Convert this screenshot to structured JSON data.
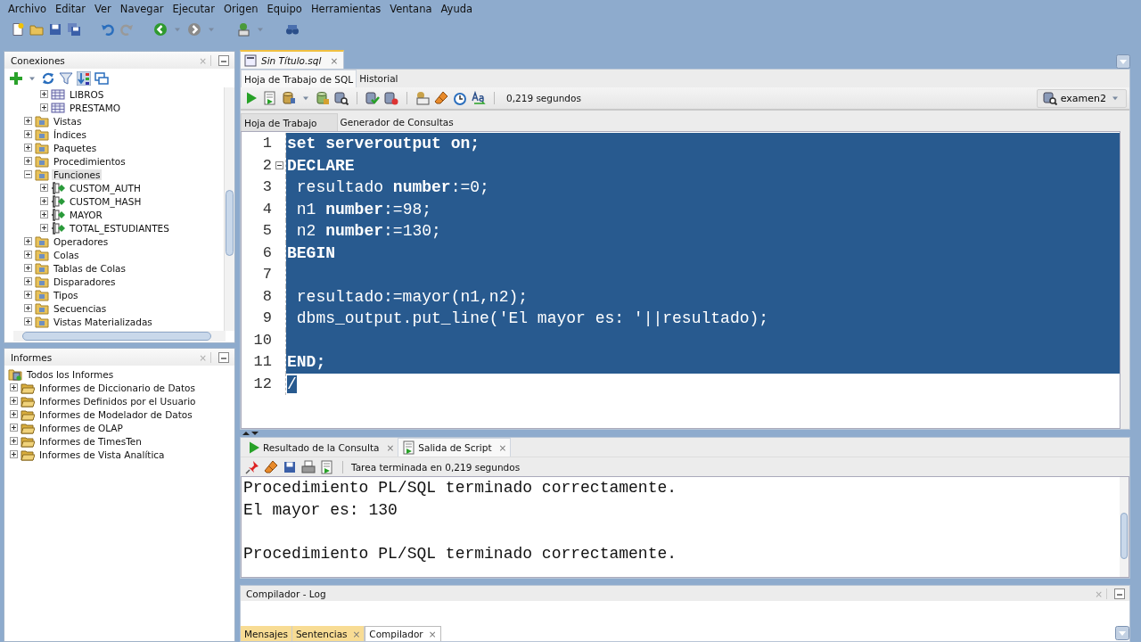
{
  "menu": [
    "Archivo",
    "Editar",
    "Ver",
    "Navegar",
    "Ejecutar",
    "Origen",
    "Equipo",
    "Herramientas",
    "Ventana",
    "Ayuda"
  ],
  "connections_panel": {
    "title": "Conexiones",
    "close_mark": "×",
    "tree": [
      {
        "kind": "group",
        "children": [
          {
            "label": "LIBROS",
            "kind": "table",
            "expanded": false,
            "selected": false
          },
          {
            "label": "PRESTAMO",
            "kind": "table",
            "expanded": false,
            "selected": false
          }
        ]
      },
      {
        "label": "Vistas",
        "kind": "folder",
        "expanded": false,
        "selected": false
      },
      {
        "label": "Índices",
        "kind": "folder",
        "expanded": false,
        "selected": false
      },
      {
        "label": "Paquetes",
        "kind": "folder",
        "expanded": false,
        "selected": false
      },
      {
        "label": "Procedimientos",
        "kind": "folder",
        "expanded": false,
        "selected": false
      },
      {
        "label": "Funciones",
        "kind": "folder",
        "expanded": true,
        "selected": true,
        "children": [
          {
            "label": "CUSTOM_AUTH",
            "kind": "function",
            "expanded": false,
            "selected": false
          },
          {
            "label": "CUSTOM_HASH",
            "kind": "function",
            "expanded": false,
            "selected": false
          },
          {
            "label": "MAYOR",
            "kind": "function",
            "expanded": false,
            "selected": false
          },
          {
            "label": "TOTAL_ESTUDIANTES",
            "kind": "function",
            "expanded": false,
            "selected": false
          }
        ]
      },
      {
        "label": "Operadores",
        "kind": "folder",
        "expanded": false,
        "selected": false
      },
      {
        "label": "Colas",
        "kind": "folder",
        "expanded": false,
        "selected": false
      },
      {
        "label": "Tablas de Colas",
        "kind": "folder",
        "expanded": false,
        "selected": false
      },
      {
        "label": "Disparadores",
        "kind": "folder",
        "expanded": false,
        "selected": false
      },
      {
        "label": "Tipos",
        "kind": "folder",
        "expanded": false,
        "selected": false
      },
      {
        "label": "Secuencias",
        "kind": "folder",
        "expanded": false,
        "selected": false
      },
      {
        "label": "Vistas Materializadas",
        "kind": "folder",
        "expanded": false,
        "selected": false
      }
    ]
  },
  "reports_panel": {
    "title": "Informes",
    "close_mark": "×",
    "tree": [
      {
        "label": "Todos los Informes",
        "kind": "reports",
        "selected": false,
        "children": [
          {
            "label": "Informes de Diccionario de Datos",
            "kind": "folder",
            "expanded": false,
            "selected": false
          },
          {
            "label": "Informes Definidos por el Usuario",
            "kind": "folder",
            "expanded": false,
            "selected": false
          },
          {
            "label": "Informes de Modelador de Datos",
            "kind": "folder",
            "expanded": false,
            "selected": false
          },
          {
            "label": "Informes de OLAP",
            "kind": "folder",
            "expanded": false,
            "selected": false
          },
          {
            "label": "Informes de TimesTen",
            "kind": "folder",
            "expanded": false,
            "selected": false
          },
          {
            "label": "Informes de Vista Analítica",
            "kind": "folder",
            "expanded": false,
            "selected": false
          }
        ]
      }
    ]
  },
  "document_tabs": [
    {
      "label": "Sin Título.sql",
      "close_mark": "×",
      "selected": true
    }
  ],
  "editor_tabs": [
    {
      "label": "Hoja de Trabajo de SQL",
      "selected": true
    },
    {
      "label": "Historial",
      "selected": false
    }
  ],
  "editor_toolbar": {
    "elapsed": "0,219 segundos",
    "connection": "examen2"
  },
  "worksheet_tabs": [
    {
      "label": "Hoja de Trabajo",
      "selected": true
    },
    {
      "label": "Generador de Consultas",
      "selected": false
    }
  ],
  "code_lines": [
    {
      "number": "1",
      "text": "set serveroutput on;",
      "bold": true,
      "selected": true
    },
    {
      "number": "2",
      "text": "DECLARE",
      "bold": true,
      "collapsible": true,
      "selected": true
    },
    {
      "number": "3",
      "text": " resultado **number**:=0;",
      "selected": true
    },
    {
      "number": "4",
      "text": " n1 **number**:=98;",
      "selected": true
    },
    {
      "number": "5",
      "text": " n2 **number**:=130;",
      "selected": true
    },
    {
      "number": "6",
      "text": "BEGIN",
      "bold": true,
      "selected": true
    },
    {
      "number": "7",
      "selected": true
    },
    {
      "number": "8",
      "text": " resultado:=mayor(n1,n2);",
      "selected": true
    },
    {
      "number": "9",
      "text": " dbms_output.put_line('El mayor es: '||resultado);",
      "selected": true
    },
    {
      "number": "10",
      "selected": true
    },
    {
      "number": "11",
      "text": "END;",
      "bold": true,
      "selected": true
    },
    {
      "number": "12",
      "text": "/",
      "text_selected": true
    }
  ],
  "result_tabs": [
    {
      "label": "Resultado de la Consulta",
      "kind": "query",
      "close_mark": "×",
      "selected": false
    },
    {
      "label": "Salida de Script",
      "kind": "script",
      "close_mark": "×",
      "selected": true
    }
  ],
  "output_status": "Tarea terminada en 0,219 segundos",
  "output_lines": [
    {
      "text": "Procedimiento PL/SQL terminado correctamente."
    },
    {
      "text": "El mayor es: 130"
    },
    {
      "text": "Procedimiento PL/SQL terminado correctamente.",
      "blank_before": true
    }
  ],
  "log_panel": {
    "title": "Compilador - Log",
    "close_mark": "×",
    "tabs": [
      {
        "label": "Mensajes",
        "selected": false
      },
      {
        "label": "Sentencias",
        "close_mark": "×",
        "selected": false
      },
      {
        "label": "Compilador",
        "close_mark": "×",
        "selected": true
      }
    ]
  }
}
